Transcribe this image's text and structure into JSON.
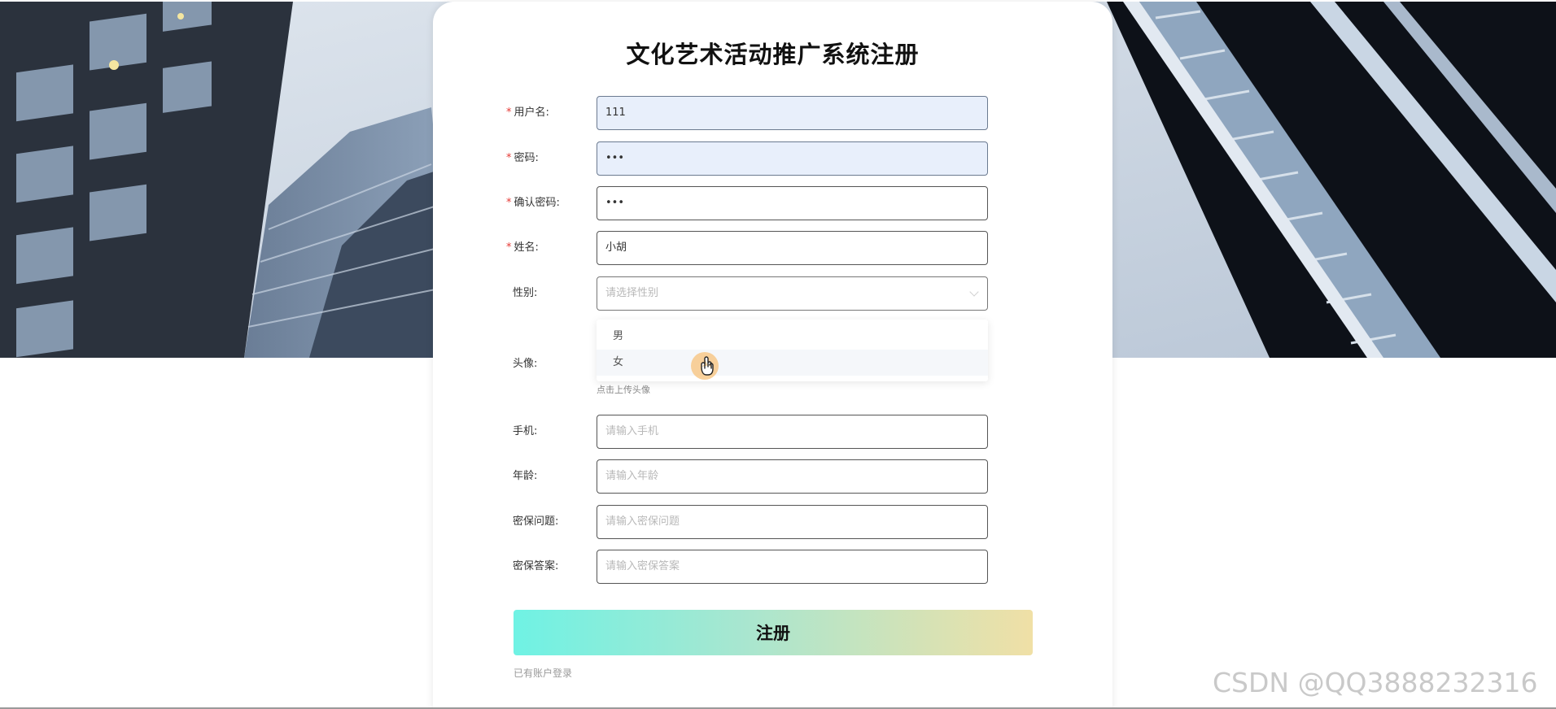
{
  "page": {
    "title": "文化艺术活动推广系统注册"
  },
  "form": {
    "username": {
      "label": "用户名:",
      "value": "111",
      "required": true
    },
    "password": {
      "label": "密码:",
      "value": "•••",
      "required": true
    },
    "confirm_password": {
      "label": "确认密码:",
      "value": "•••",
      "required": true
    },
    "name": {
      "label": "姓名:",
      "value": "小胡",
      "required": true
    },
    "gender": {
      "label": "性别:",
      "placeholder": "请选择性别",
      "required": false
    },
    "avatar": {
      "label": "头像:",
      "hint": "点击上传头像"
    },
    "phone": {
      "label": "手机:",
      "placeholder": "请输入手机"
    },
    "age": {
      "label": "年龄:",
      "placeholder": "请输入年龄"
    },
    "security_question": {
      "label": "密保问题:",
      "placeholder": "请输入密保问题"
    },
    "security_answer": {
      "label": "密保答案:",
      "placeholder": "请输入密保答案"
    },
    "required_mark": "*"
  },
  "gender_dropdown": {
    "options": [
      "男",
      "女"
    ],
    "hovered_index": 1
  },
  "actions": {
    "submit_label": "注册",
    "login_link": "已有账户登录"
  },
  "watermark": "CSDN @QQ3888232316",
  "colors": {
    "required": "#e53935",
    "button_gradient_start": "#6ff2e4",
    "button_gradient_end": "#f0e0a6",
    "autofill_bg": "#e8effb"
  }
}
